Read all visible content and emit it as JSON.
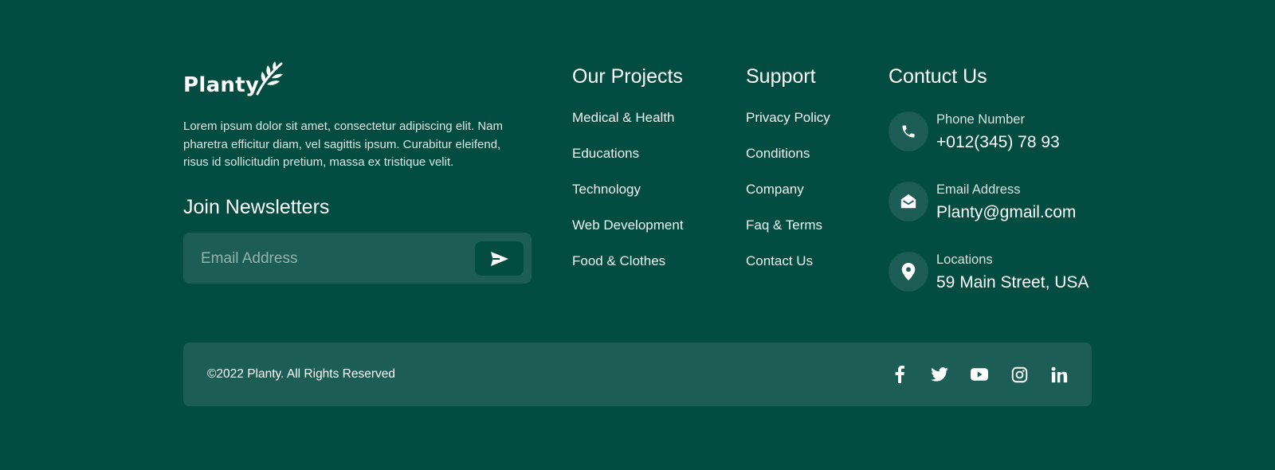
{
  "brand": {
    "name": "Planty",
    "description": "Lorem ipsum dolor sit amet, consectetur adipiscing elit. Nam pharetra efficitur diam, vel sagittis ipsum. Curabitur eleifend, risus id sollicitudin pretium, massa ex tristique velit."
  },
  "newsletter": {
    "title": "Join Newsletters",
    "placeholder": "Email Address",
    "send_icon": "send-icon"
  },
  "projects": {
    "title": "Our Projects",
    "items": [
      "Medical & Health",
      "Educations",
      "Technology",
      "Web Development",
      "Food & Clothes"
    ]
  },
  "support": {
    "title": "Support",
    "items": [
      "Privacy Policy",
      "Conditions",
      "Company",
      "Faq & Terms",
      "Contact Us"
    ]
  },
  "contact": {
    "title": "Contuct Us",
    "items": [
      {
        "icon": "phone-icon",
        "label": "Phone Number",
        "value": "+012(345) 78 93"
      },
      {
        "icon": "envelope-open-icon",
        "label": "Email Address",
        "value": "Planty@gmail.com"
      },
      {
        "icon": "location-pin-icon",
        "label": "Locations",
        "value": "59 Main Street, USA"
      }
    ]
  },
  "footer": {
    "copyright": "©2022 Planty. All Rights Reserved",
    "socials": [
      "facebook-icon",
      "twitter-icon",
      "youtube-icon",
      "instagram-icon",
      "linkedin-icon"
    ]
  },
  "colors": {
    "background": "#024c41",
    "panel": "#1c5e55",
    "text": "#ffffff",
    "muted_text": "#dce9e6"
  }
}
